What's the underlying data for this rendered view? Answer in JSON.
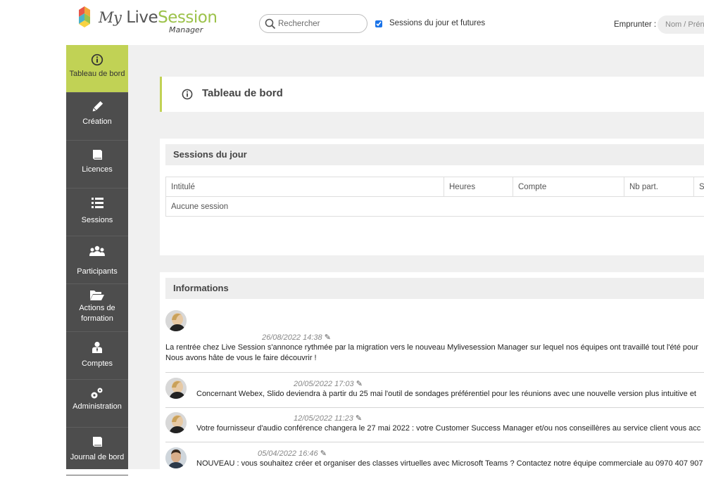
{
  "header": {
    "logo": {
      "my": "My",
      "live": "Live",
      "session": "Session",
      "sub": "Manager"
    },
    "search": {
      "placeholder": "Rechercher"
    },
    "sessions_filter_label": "Sessions du jour et futures",
    "sessions_filter_checked": true,
    "borrow_label": "Emprunter :",
    "borrow_placeholder": "Nom / Prénom"
  },
  "sidebar": {
    "items": [
      {
        "label": "Tableau de bord",
        "icon": "info-icon",
        "active": true
      },
      {
        "label": "Création",
        "icon": "pencil-icon"
      },
      {
        "label": "Licences",
        "icon": "book-icon"
      },
      {
        "label": "Sessions",
        "icon": "list-icon"
      },
      {
        "label": "Participants",
        "icon": "users-icon"
      },
      {
        "label": "Actions de formation",
        "icon": "folder-open-icon"
      },
      {
        "label": "Comptes",
        "icon": "user-icon"
      },
      {
        "label": "Administration",
        "icon": "gears-icon"
      },
      {
        "label": "Journal de bord",
        "icon": "book-icon"
      }
    ]
  },
  "page": {
    "title": "Tableau de bord"
  },
  "sessions_panel": {
    "title": "Sessions du jour",
    "columns": [
      "Intitulé",
      "Heures",
      "Compte",
      "Nb part.",
      "St"
    ],
    "empty_text": "Aucune session"
  },
  "info_panel": {
    "title": "Informations",
    "items": [
      {
        "date": "26/08/2022 14:38",
        "text_line1": "La rentrée chez Live Session s'annonce rythmée par la migration vers le nouveau Mylivesession Manager sur lequel nos équipes ont travaillé tout l'été pour",
        "text_line2": "Nous avons hâte de vous le faire découvrir !",
        "avatar": "woman"
      },
      {
        "date": "20/05/2022 17:03",
        "text_line1": "Concernant Webex, Slido deviendra à partir du 25 mai l'outil de sondages préférentiel pour les réunions avec une nouvelle version plus intuitive et",
        "avatar": "woman"
      },
      {
        "date": "12/05/2022 11:23",
        "text_line1": "Votre fournisseur d'audio conférence changera le 27 mai 2022 : votre Customer Success Manager et/ou nos conseillères au service client vous acc",
        "avatar": "woman"
      },
      {
        "date": "05/04/2022 16:46",
        "text_line1": "NOUVEAU : vous souhaitez créer et organiser des classes virtuelles avec Microsoft Teams ? Contactez notre équipe commerciale au 0970 407 907",
        "avatar": "man"
      }
    ]
  },
  "colors": {
    "accent": "#c1d255",
    "sidebar": "#4d4d4d",
    "background": "#f0f0f0"
  }
}
